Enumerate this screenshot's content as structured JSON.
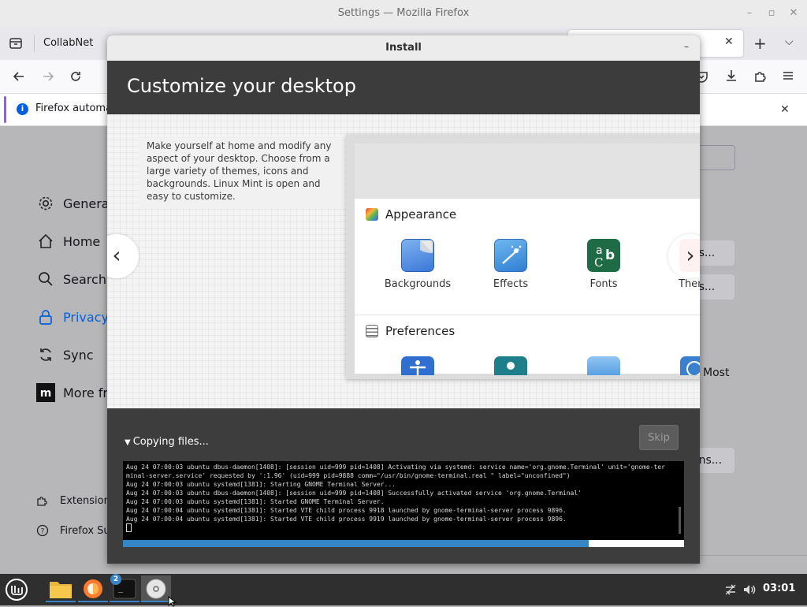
{
  "firefox": {
    "window_title": "Settings — Mozilla Firefox",
    "tab_label": "CollabNet",
    "notification_text": "Firefox automa",
    "sidebar": {
      "items": [
        {
          "label": "General"
        },
        {
          "label": "Home"
        },
        {
          "label": "Search"
        },
        {
          "label": "Privacy"
        },
        {
          "label": "Sync"
        },
        {
          "label": "More fr"
        }
      ],
      "footer": [
        {
          "label": "Extension"
        },
        {
          "label": "Firefox Su"
        }
      ]
    },
    "content_fragments": {
      "button1": "es...",
      "button2": "es...",
      "button3": "ons...",
      "most_text": "Most"
    }
  },
  "installer": {
    "title": "Install",
    "heading": "Customize your desktop",
    "slide_text": "Make yourself at home and modify any aspect of your desktop. Choose from a large variety of themes, icons and backgrounds. Linux Mint is open and easy to customize.",
    "mock": {
      "section1": "Appearance",
      "items": [
        {
          "label": "Backgrounds",
          "icon": "backgrounds-icon"
        },
        {
          "label": "Effects",
          "icon": "effects-icon"
        },
        {
          "label": "Fonts",
          "icon": "fonts-icon"
        },
        {
          "label": "Ther",
          "icon": "themes-icon"
        }
      ],
      "section2": "Preferences"
    },
    "progress_label": "Copying files...",
    "skip_label": "Skip",
    "terminal_lines": [
      "Aug 24 07:00:03 ubuntu dbus-daemon[1408]: [session uid=999 pid=1408] Activating via systemd: service name='org.gnome.Terminal' unit='gnome-ter",
      "minal-server.service' requested by ':1.96' (uid=999 pid=9888 comm=\"/usr/bin/gnome-terminal.real \" label=\"unconfined\")",
      "Aug 24 07:00:03 ubuntu systemd[1381]: Starting GNOME Terminal Server...",
      "Aug 24 07:00:03 ubuntu dbus-daemon[1408]: [session uid=999 pid=1408] Successfully activated service 'org.gnome.Terminal'",
      "Aug 24 07:00:03 ubuntu systemd[1381]: Started GNOME Terminal Server.",
      "Aug 24 07:00:04 ubuntu systemd[1381]: Started VTE child process 9918 launched by gnome-terminal-server process 9896.",
      "Aug 24 07:00:04 ubuntu systemd[1381]: Started VTE child process 9919 launched by gnome-terminal-server process 9896."
    ],
    "progress_fraction": 0.83
  },
  "taskbar": {
    "terminal_badge": "2",
    "clock": "03:01"
  },
  "colors": {
    "accent_blue": "#3584c4",
    "firefox_blue": "#0060df",
    "dialog_dark": "#3c3c3c"
  }
}
